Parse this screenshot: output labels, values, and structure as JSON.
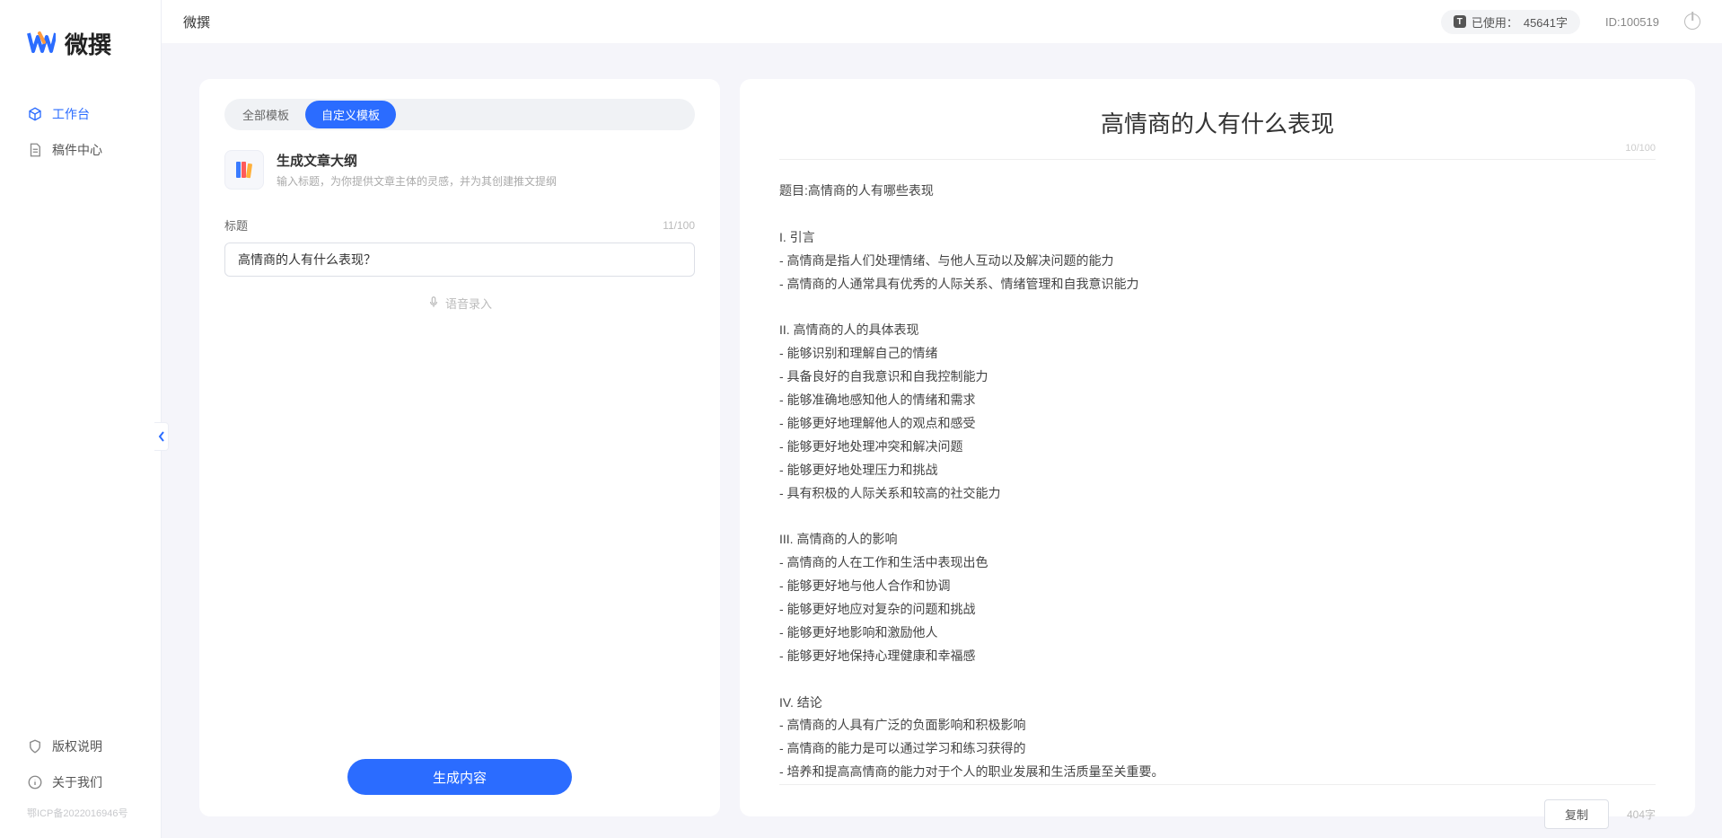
{
  "app": {
    "name": "微撰"
  },
  "topbar": {
    "usage_prefix": "已使用：",
    "usage_value": "45641字",
    "id_label": "ID:100519"
  },
  "sidebar": {
    "logo_text": "微撰",
    "nav": [
      {
        "label": "工作台",
        "active": true
      },
      {
        "label": "稿件中心",
        "active": false
      }
    ],
    "bottom": [
      {
        "label": "版权说明"
      },
      {
        "label": "关于我们"
      }
    ],
    "icp": "鄂ICP备2022016946号"
  },
  "left": {
    "tabs": [
      {
        "label": "全部模板",
        "active": false
      },
      {
        "label": "自定义模板",
        "active": true
      }
    ],
    "template": {
      "title": "生成文章大纲",
      "desc": "输入标题，为你提供文章主体的灵感，并为其创建推文提纲"
    },
    "title_field": {
      "label": "标题",
      "count": "11/100",
      "value": "高情商的人有什么表现？"
    },
    "voice_label": "语音录入",
    "generate_label": "生成内容"
  },
  "right": {
    "title": "高情商的人有什么表现",
    "title_count": "10/100",
    "body": "题目:高情商的人有哪些表现\n\nI. 引言\n- 高情商是指人们处理情绪、与他人互动以及解决问题的能力\n- 高情商的人通常具有优秀的人际关系、情绪管理和自我意识能力\n\nII. 高情商的人的具体表现\n- 能够识别和理解自己的情绪\n- 具备良好的自我意识和自我控制能力\n- 能够准确地感知他人的情绪和需求\n- 能够更好地理解他人的观点和感受\n- 能够更好地处理冲突和解决问题\n- 能够更好地处理压力和挑战\n- 具有积极的人际关系和较高的社交能力\n\nIII. 高情商的人的影响\n- 高情商的人在工作和生活中表现出色\n- 能够更好地与他人合作和协调\n- 能够更好地应对复杂的问题和挑战\n- 能够更好地影响和激励他人\n- 能够更好地保持心理健康和幸福感\n\nIV. 结论\n- 高情商的人具有广泛的负面影响和积极影响\n- 高情商的能力是可以通过学习和练习获得的\n- 培养和提高高情商的能力对于个人的职业发展和生活质量至关重要。",
    "copy_label": "复制",
    "word_count": "404字"
  }
}
